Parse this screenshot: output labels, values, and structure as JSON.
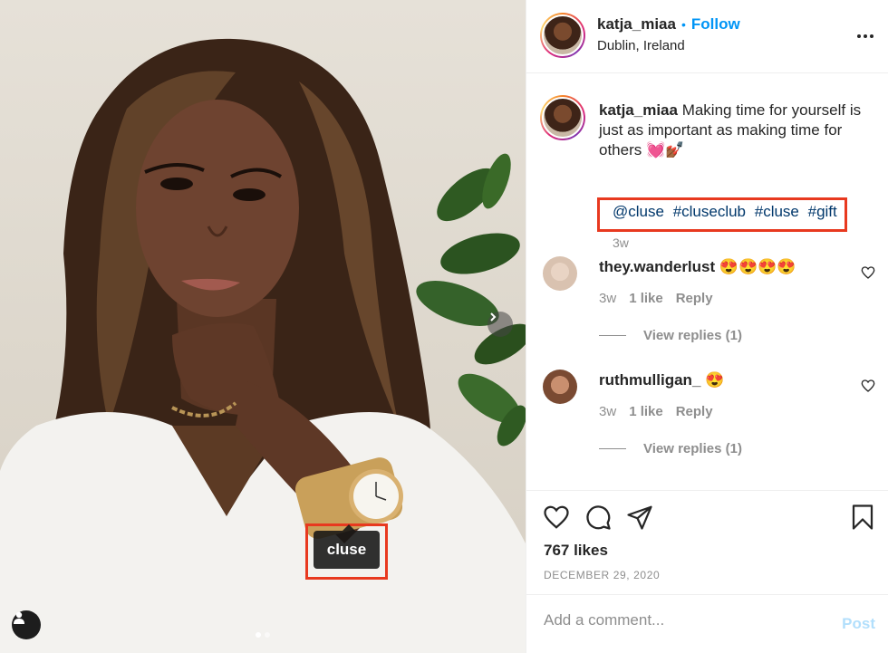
{
  "post": {
    "author": "katja_miaa",
    "follow_label": "Follow",
    "separator": "•",
    "location": "Dublin, Ireland",
    "photo_tag": "cluse"
  },
  "caption": {
    "username": "katja_miaa",
    "text": "Making time for yourself is just as important as making time for others 💓💅🏾",
    "hashtags": [
      "@cluse",
      "#cluseclub",
      "#cluse",
      "#gift"
    ],
    "time": "3w"
  },
  "comments": [
    {
      "username": "they.wanderlust",
      "text": "😍😍😍😍",
      "time": "3w",
      "likes": "1 like",
      "reply_label": "Reply",
      "view_replies": "View replies (1)"
    },
    {
      "username": "ruthmulligan_",
      "text": "😍",
      "time": "3w",
      "likes": "1 like",
      "reply_label": "Reply",
      "view_replies": "View replies (1)"
    }
  ],
  "actions": {
    "likes": "767 likes",
    "date": "DECEMBER 29, 2020"
  },
  "comment_box": {
    "placeholder": "Add a comment...",
    "post_label": "Post"
  },
  "colors": {
    "link": "#0095f6",
    "hashtag": "#00376b",
    "highlight": "#e8391f",
    "muted": "#8e8e8e"
  },
  "icons": [
    "next-arrow-icon",
    "user-tag-icon",
    "more-options-icon",
    "heart-icon",
    "comment-icon",
    "share-icon",
    "bookmark-icon"
  ]
}
